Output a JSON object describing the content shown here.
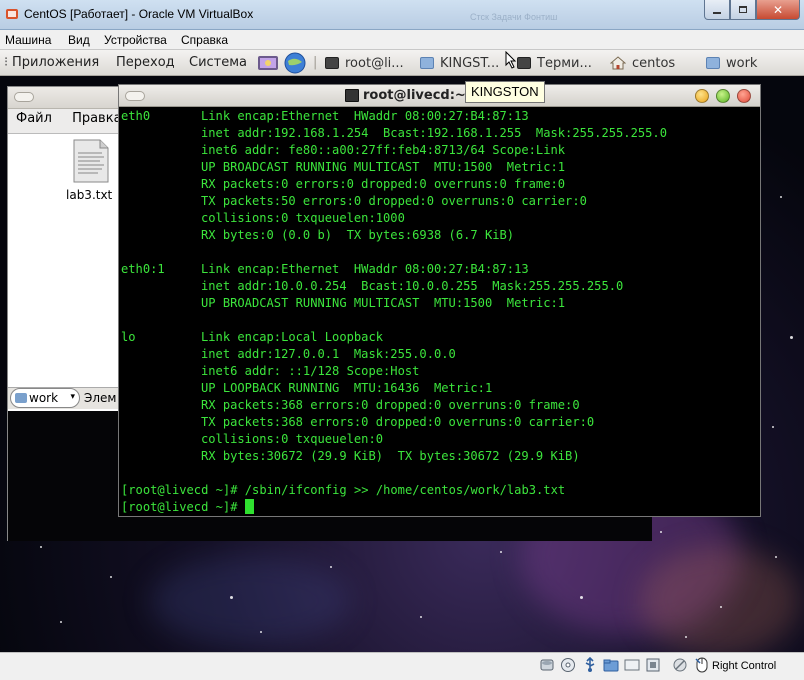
{
  "window": {
    "title": "CentOS [Работает] - Oracle VM VirtualBox",
    "ghost_text": "Стск  Задачи  Фонтиш"
  },
  "vbox_menu": [
    "Машина",
    "Вид",
    "Устройства",
    "Справка"
  ],
  "gnome_panel": {
    "menus": [
      "Приложения",
      "Переход",
      "Система"
    ],
    "tasks": [
      {
        "label": "root@li...",
        "icon": "terminal-icon"
      },
      {
        "label": "KINGST...",
        "icon": "folder-icon"
      },
      {
        "label": "Терми...",
        "icon": "terminal-icon"
      },
      {
        "label": "centos",
        "icon": "home-icon"
      },
      {
        "label": "work",
        "icon": "folder-icon"
      }
    ]
  },
  "tooltip": "KINGSTON",
  "file_manager": {
    "menu": [
      "Файл",
      "Правка"
    ],
    "file_label": "lab3.txt",
    "path_value": "work",
    "elements_label": "Элем"
  },
  "terminal": {
    "title": "root@livecd:~",
    "lines": [
      {
        "c1": "eth0",
        "c2": "Link encap:Ethernet  HWaddr 08:00:27:B4:87:13"
      },
      {
        "c1": "",
        "c2": "inet addr:192.168.1.254  Bcast:192.168.1.255  Mask:255.255.255.0"
      },
      {
        "c1": "",
        "c2": "inet6 addr: fe80::a00:27ff:feb4:8713/64 Scope:Link"
      },
      {
        "c1": "",
        "c2": "UP BROADCAST RUNNING MULTICAST  MTU:1500  Metric:1"
      },
      {
        "c1": "",
        "c2": "RX packets:0 errors:0 dropped:0 overruns:0 frame:0"
      },
      {
        "c1": "",
        "c2": "TX packets:50 errors:0 dropped:0 overruns:0 carrier:0"
      },
      {
        "c1": "",
        "c2": "collisions:0 txqueuelen:1000"
      },
      {
        "c1": "",
        "c2": "RX bytes:0 (0.0 b)  TX bytes:6938 (6.7 KiB)"
      },
      {
        "c1": "",
        "c2": ""
      },
      {
        "c1": "eth0:1",
        "c2": "Link encap:Ethernet  HWaddr 08:00:27:B4:87:13"
      },
      {
        "c1": "",
        "c2": "inet addr:10.0.0.254  Bcast:10.0.0.255  Mask:255.255.255.0"
      },
      {
        "c1": "",
        "c2": "UP BROADCAST RUNNING MULTICAST  MTU:1500  Metric:1"
      },
      {
        "c1": "",
        "c2": ""
      },
      {
        "c1": "lo",
        "c2": "Link encap:Local Loopback"
      },
      {
        "c1": "",
        "c2": "inet addr:127.0.0.1  Mask:255.0.0.0"
      },
      {
        "c1": "",
        "c2": "inet6 addr: ::1/128 Scope:Host"
      },
      {
        "c1": "",
        "c2": "UP LOOPBACK RUNNING  MTU:16436  Metric:1"
      },
      {
        "c1": "",
        "c2": "RX packets:368 errors:0 dropped:0 overruns:0 frame:0"
      },
      {
        "c1": "",
        "c2": "TX packets:368 errors:0 dropped:0 overruns:0 carrier:0"
      },
      {
        "c1": "",
        "c2": "collisions:0 txqueuelen:0"
      },
      {
        "c1": "",
        "c2": "RX bytes:30672 (29.9 KiB)  TX bytes:30672 (29.9 KiB)"
      },
      {
        "c1": "",
        "c2": ""
      }
    ],
    "command_line": "[root@livecd ~]# /sbin/ifconfig >> /home/centos/work/lab3.txt",
    "prompt": "[root@livecd ~]# "
  },
  "status_bar": {
    "host_key": "Right Control",
    "icons": [
      "hdd-icon",
      "cd-icon",
      "usb-icon",
      "shared-folder-icon",
      "display-icon",
      "network-icon",
      "capture-icon",
      "mouse-integration-icon"
    ]
  },
  "colors": {
    "terminal_text": "#3ce53c",
    "terminal_bg": "#000000",
    "close_red": "#e04b3a"
  }
}
